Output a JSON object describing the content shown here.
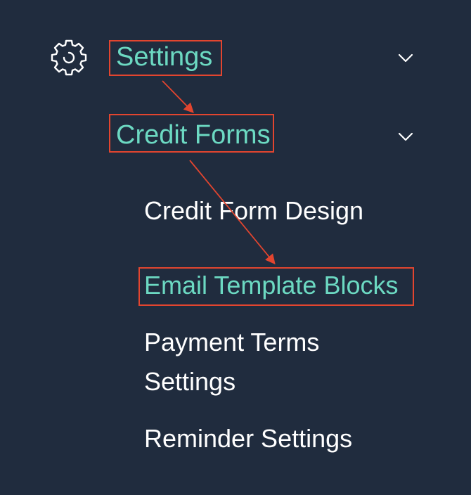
{
  "nav": {
    "settings": {
      "label": "Settings",
      "icon": "gear-icon",
      "expanded_icon": "chevron-down-icon"
    },
    "credit_forms": {
      "label": "Credit Forms",
      "expanded_icon": "chevron-down-icon"
    },
    "children": [
      {
        "label": "Credit Form Design"
      },
      {
        "label": "Email Template Blocks"
      },
      {
        "label": "Payment Terms"
      },
      {
        "label": "Settings"
      },
      {
        "label": "Reminder Settings"
      }
    ]
  },
  "colors": {
    "background": "#202c3e",
    "active_text": "#6cd9c2",
    "text": "#ffffff",
    "annotation": "#e2452f"
  }
}
